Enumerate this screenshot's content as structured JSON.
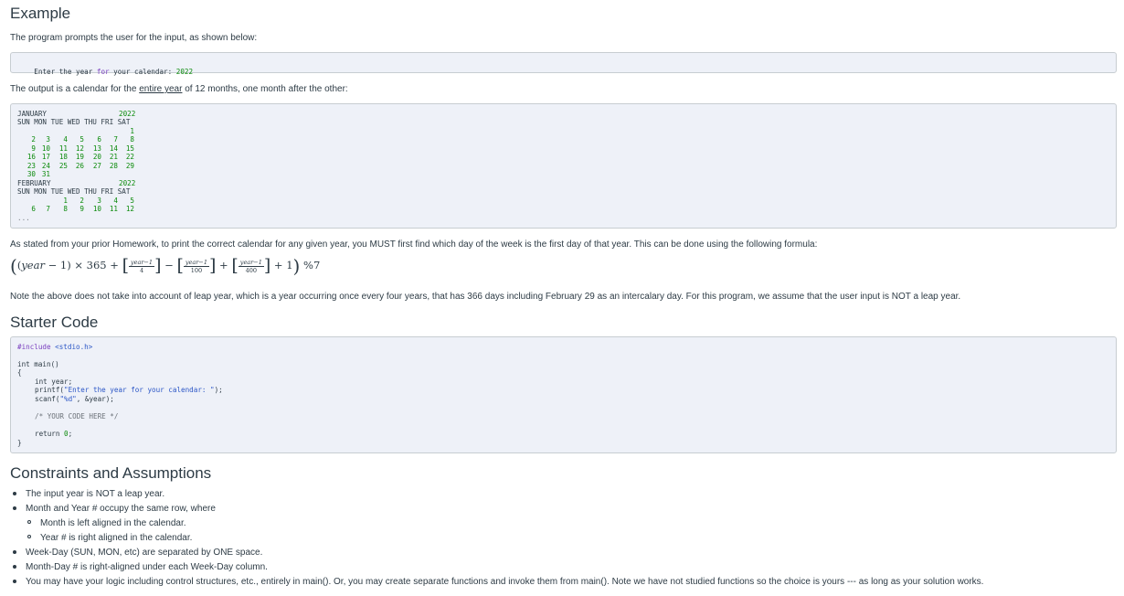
{
  "example": {
    "heading": "Example",
    "intro": "The program prompts the user for the input, as shown below:",
    "prompt_pre": "Enter the year ",
    "prompt_for": "for",
    "prompt_post": " your calendar: ",
    "prompt_value": "2022",
    "output_pre": "The output is a calendar for the ",
    "output_link": "entire year",
    "output_post": " of 12 months, one month after the other:"
  },
  "calendar": {
    "jan_label": "JANUARY",
    "feb_label": "FEBRUARY",
    "year": "2022",
    "weekday_header": "SUN MON TUE WED THU FRI SAT",
    "ellipsis": "...",
    "jan_days": [
      [
        "",
        "",
        "",
        "",
        "",
        "",
        "1"
      ],
      [
        "2",
        "3",
        "4",
        "5",
        "6",
        "7",
        "8"
      ],
      [
        "9",
        "10",
        "11",
        "12",
        "13",
        "14",
        "15"
      ],
      [
        "16",
        "17",
        "18",
        "19",
        "20",
        "21",
        "22"
      ],
      [
        "23",
        "24",
        "25",
        "26",
        "27",
        "28",
        "29"
      ],
      [
        "30",
        "31",
        "",
        "",
        "",
        "",
        ""
      ]
    ],
    "feb_days": [
      [
        "",
        "",
        "1",
        "2",
        "3",
        "4",
        "5"
      ],
      [
        "6",
        "7",
        "8",
        "9",
        "10",
        "11",
        "12"
      ]
    ]
  },
  "formula_section": {
    "intro": "As stated from your prior Homework, to print the correct calendar for any given year, you MUST first find which day of the week is the first day of that year. This can be done using the following formula:",
    "year_var": "year",
    "minus_one": " − 1) × 365 + ",
    "frac_num": "year−1",
    "den_4": "4",
    "den_100": "100",
    "den_400": "400",
    "minus": " − ",
    "plus": " + ",
    "tail": " + 1",
    "mod": "%7",
    "note": "Note the above does not take into account of leap year, which is a year occurring once every four years, that has 366 days including February 29 as an intercalary day. For this program, we assume that the user input is NOT a leap year."
  },
  "starter": {
    "heading": "Starter Code",
    "include_kw": "#include ",
    "include_file": "<stdio.h>",
    "main_sig": "int main()",
    "open_brace": "{",
    "decl": "int year;",
    "printf_pre": "printf(",
    "printf_str": "\"Enter the year for your calendar: \"",
    "printf_post": ");",
    "scanf_pre": "scanf(",
    "scanf_str": "\"%d\"",
    "scanf_post": ", &year);",
    "comment": "/* YOUR CODE HERE */",
    "return_kw": "return ",
    "return_val": "0",
    "return_end": ";",
    "close_brace": "}"
  },
  "constraints": {
    "heading": "Constraints and Assumptions",
    "items": [
      "The input year is NOT a leap year.",
      "Month and Year # occupy the same row, where",
      "Month is left aligned in the calendar.",
      "Year # is right aligned in the calendar.",
      "Week-Day (SUN, MON, etc) are separated by ONE space.",
      "Month-Day # is right-aligned under each Week-Day column.",
      "You may have your logic including control structures, etc., entirely in main(). Or, you may create separate functions and invoke them from main(). Note we have not studied functions so the choice is yours --- as long as your solution works."
    ]
  }
}
